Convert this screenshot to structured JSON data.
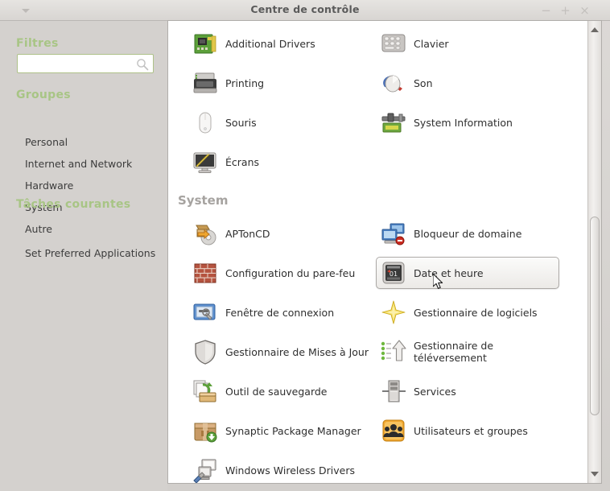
{
  "window": {
    "title": "Centre de contrôle",
    "menu_icon": "chevron-down-icon",
    "minimize_label": "−",
    "maximize_label": "+",
    "close_label": "×"
  },
  "sidebar": {
    "filters_heading": "Filtres",
    "search": {
      "value": "",
      "placeholder": ""
    },
    "groups_heading": "Groupes",
    "groups": [
      {
        "label": "Personal"
      },
      {
        "label": "Internet and Network"
      },
      {
        "label": "Hardware"
      },
      {
        "label": "System"
      },
      {
        "label": "Autre"
      }
    ],
    "tasks_heading": "Tâches courantes",
    "tasks": [
      {
        "label": "Set Preferred Applications"
      }
    ]
  },
  "main": {
    "sections": [
      {
        "heading": "",
        "items": [
          {
            "label": "Additional Drivers",
            "icon": "circuit-board-icon",
            "col": "left",
            "selected": false
          },
          {
            "label": "Clavier",
            "icon": "keyboard-icon",
            "col": "right",
            "selected": false
          },
          {
            "label": "Printing",
            "icon": "printer-icon",
            "col": "left",
            "selected": false
          },
          {
            "label": "Son",
            "icon": "sound-icon",
            "col": "right",
            "selected": false
          },
          {
            "label": "Souris",
            "icon": "mouse-icon",
            "col": "left",
            "selected": false
          },
          {
            "label": "System Information",
            "icon": "caliper-icon",
            "col": "right",
            "selected": false
          },
          {
            "label": "Écrans",
            "icon": "display-icon",
            "col": "left",
            "selected": false
          }
        ]
      },
      {
        "heading": "System",
        "items": [
          {
            "label": "APTonCD",
            "icon": "aptoncd-icon",
            "col": "left",
            "selected": false
          },
          {
            "label": "Bloqueur de domaine",
            "icon": "domain-block-icon",
            "col": "right",
            "selected": false
          },
          {
            "label": "Configuration du pare-feu",
            "icon": "firewall-icon",
            "col": "left",
            "selected": false
          },
          {
            "label": "Date et heure",
            "icon": "clock-calendar-icon",
            "col": "right",
            "selected": true
          },
          {
            "label": "Fenêtre de connexion",
            "icon": "login-window-icon",
            "col": "left",
            "selected": false
          },
          {
            "label": "Gestionnaire de logiciels",
            "icon": "star-icon",
            "col": "right",
            "selected": false
          },
          {
            "label": "Gestionnaire de Mises à Jour",
            "icon": "shield-icon",
            "col": "left",
            "selected": false
          },
          {
            "label": "Gestionnaire de téléversement",
            "icon": "upload-icon",
            "col": "right",
            "selected": false
          },
          {
            "label": "Outil de sauvegarde",
            "icon": "backup-icon",
            "col": "left",
            "selected": false
          },
          {
            "label": "Services",
            "icon": "server-icon",
            "col": "right",
            "selected": false
          },
          {
            "label": "Synaptic Package Manager",
            "icon": "package-icon",
            "col": "left",
            "selected": false
          },
          {
            "label": "Utilisateurs et groupes",
            "icon": "users-icon",
            "col": "right",
            "selected": false
          },
          {
            "label": "Windows Wireless Drivers",
            "icon": "wireless-driver-icon",
            "col": "left",
            "selected": false
          }
        ]
      }
    ]
  },
  "scrollbar": {
    "up_icon": "triangle-up-icon",
    "down_icon": "triangle-down-icon"
  },
  "colors": {
    "accent_green": "#a8c585",
    "window_bg": "#d4d1ce",
    "content_bg": "#ffffff",
    "title_text": "#5a5a5a"
  }
}
